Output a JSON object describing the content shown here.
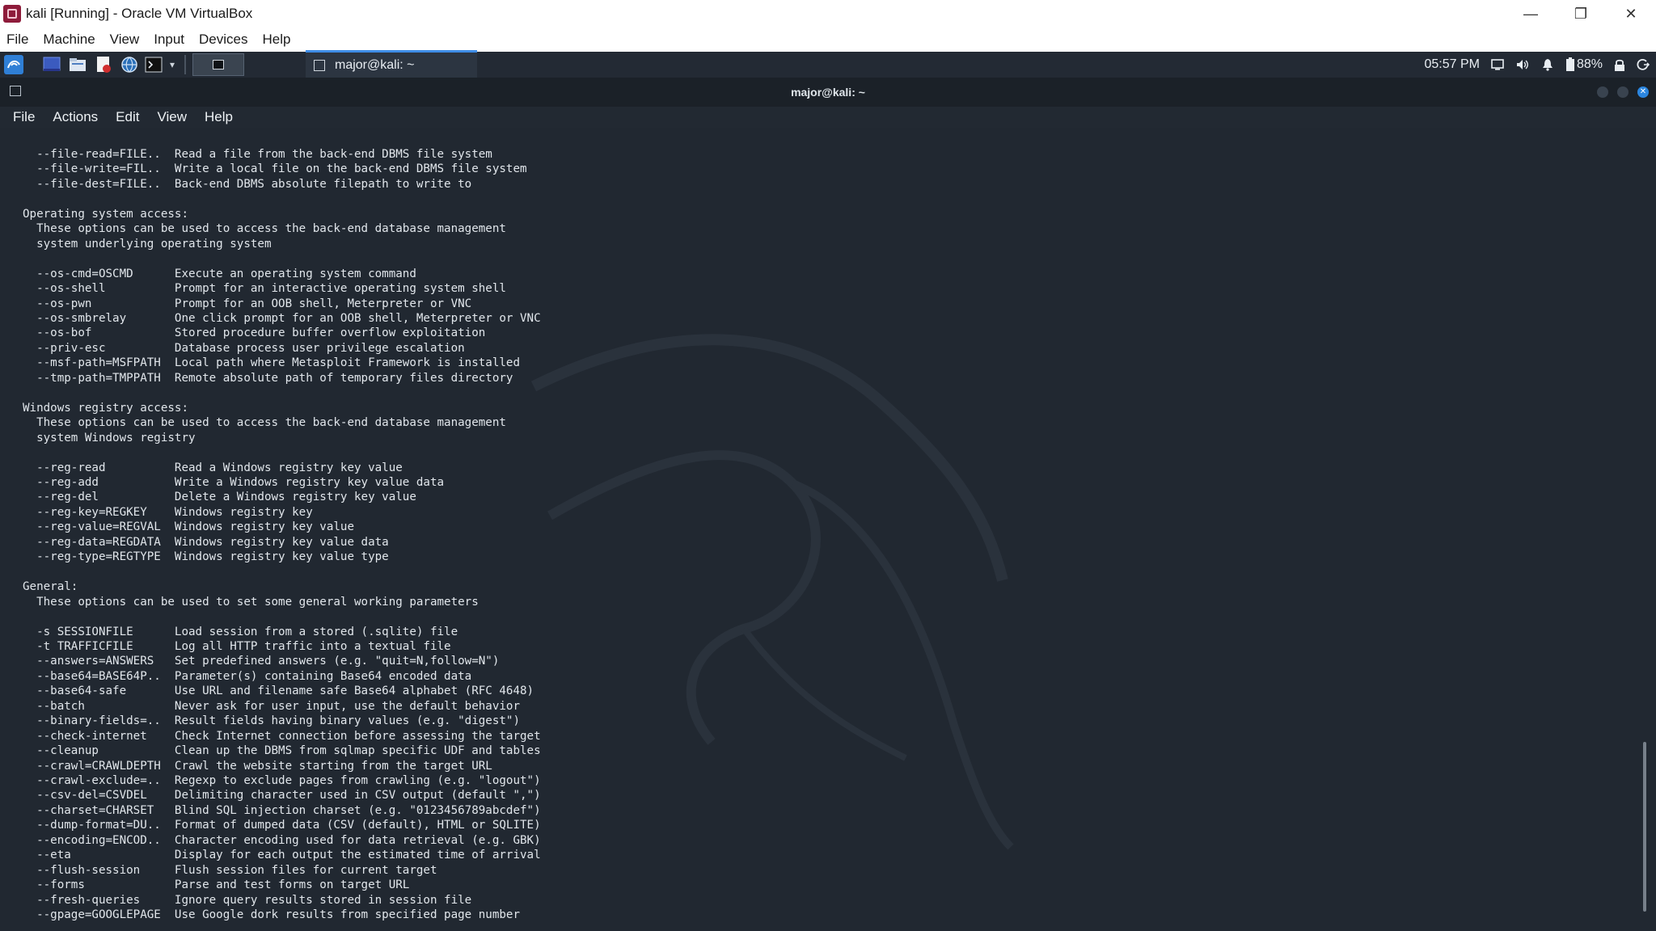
{
  "vbox": {
    "title": "kali [Running] - Oracle VM VirtualBox",
    "menu": [
      "File",
      "Machine",
      "View",
      "Input",
      "Devices",
      "Help"
    ],
    "controls": {
      "minimize": "—",
      "restore": "❐",
      "close": "✕"
    }
  },
  "panel": {
    "task_label": "major@kali: ~",
    "time": "05:57 PM",
    "battery": "88%"
  },
  "terminal": {
    "title": "major@kali: ~",
    "menu": [
      "File",
      "Actions",
      "Edit",
      "View",
      "Help"
    ],
    "lines": [
      "  --file-read=FILE..  Read a file from the back-end DBMS file system",
      "  --file-write=FIL..  Write a local file on the back-end DBMS file system",
      "  --file-dest=FILE..  Back-end DBMS absolute filepath to write to",
      "",
      "Operating system access:",
      "  These options can be used to access the back-end database management",
      "  system underlying operating system",
      "",
      "  --os-cmd=OSCMD      Execute an operating system command",
      "  --os-shell          Prompt for an interactive operating system shell",
      "  --os-pwn            Prompt for an OOB shell, Meterpreter or VNC",
      "  --os-smbrelay       One click prompt for an OOB shell, Meterpreter or VNC",
      "  --os-bof            Stored procedure buffer overflow exploitation",
      "  --priv-esc          Database process user privilege escalation",
      "  --msf-path=MSFPATH  Local path where Metasploit Framework is installed",
      "  --tmp-path=TMPPATH  Remote absolute path of temporary files directory",
      "",
      "Windows registry access:",
      "  These options can be used to access the back-end database management",
      "  system Windows registry",
      "",
      "  --reg-read          Read a Windows registry key value",
      "  --reg-add           Write a Windows registry key value data",
      "  --reg-del           Delete a Windows registry key value",
      "  --reg-key=REGKEY    Windows registry key",
      "  --reg-value=REGVAL  Windows registry key value",
      "  --reg-data=REGDATA  Windows registry key value data",
      "  --reg-type=REGTYPE  Windows registry key value type",
      "",
      "General:",
      "  These options can be used to set some general working parameters",
      "",
      "  -s SESSIONFILE      Load session from a stored (.sqlite) file",
      "  -t TRAFFICFILE      Log all HTTP traffic into a textual file",
      "  --answers=ANSWERS   Set predefined answers (e.g. \"quit=N,follow=N\")",
      "  --base64=BASE64P..  Parameter(s) containing Base64 encoded data",
      "  --base64-safe       Use URL and filename safe Base64 alphabet (RFC 4648)",
      "  --batch             Never ask for user input, use the default behavior",
      "  --binary-fields=..  Result fields having binary values (e.g. \"digest\")",
      "  --check-internet    Check Internet connection before assessing the target",
      "  --cleanup           Clean up the DBMS from sqlmap specific UDF and tables",
      "  --crawl=CRAWLDEPTH  Crawl the website starting from the target URL",
      "  --crawl-exclude=..  Regexp to exclude pages from crawling (e.g. \"logout\")",
      "  --csv-del=CSVDEL    Delimiting character used in CSV output (default \",\")",
      "  --charset=CHARSET   Blind SQL injection charset (e.g. \"0123456789abcdef\")",
      "  --dump-format=DU..  Format of dumped data (CSV (default), HTML or SQLITE)",
      "  --encoding=ENCOD..  Character encoding used for data retrieval (e.g. GBK)",
      "  --eta               Display for each output the estimated time of arrival",
      "  --flush-session     Flush session files for current target",
      "  --forms             Parse and test forms on target URL",
      "  --fresh-queries     Ignore query results stored in session file",
      "  --gpage=GOOGLEPAGE  Use Google dork results from specified page number"
    ]
  }
}
